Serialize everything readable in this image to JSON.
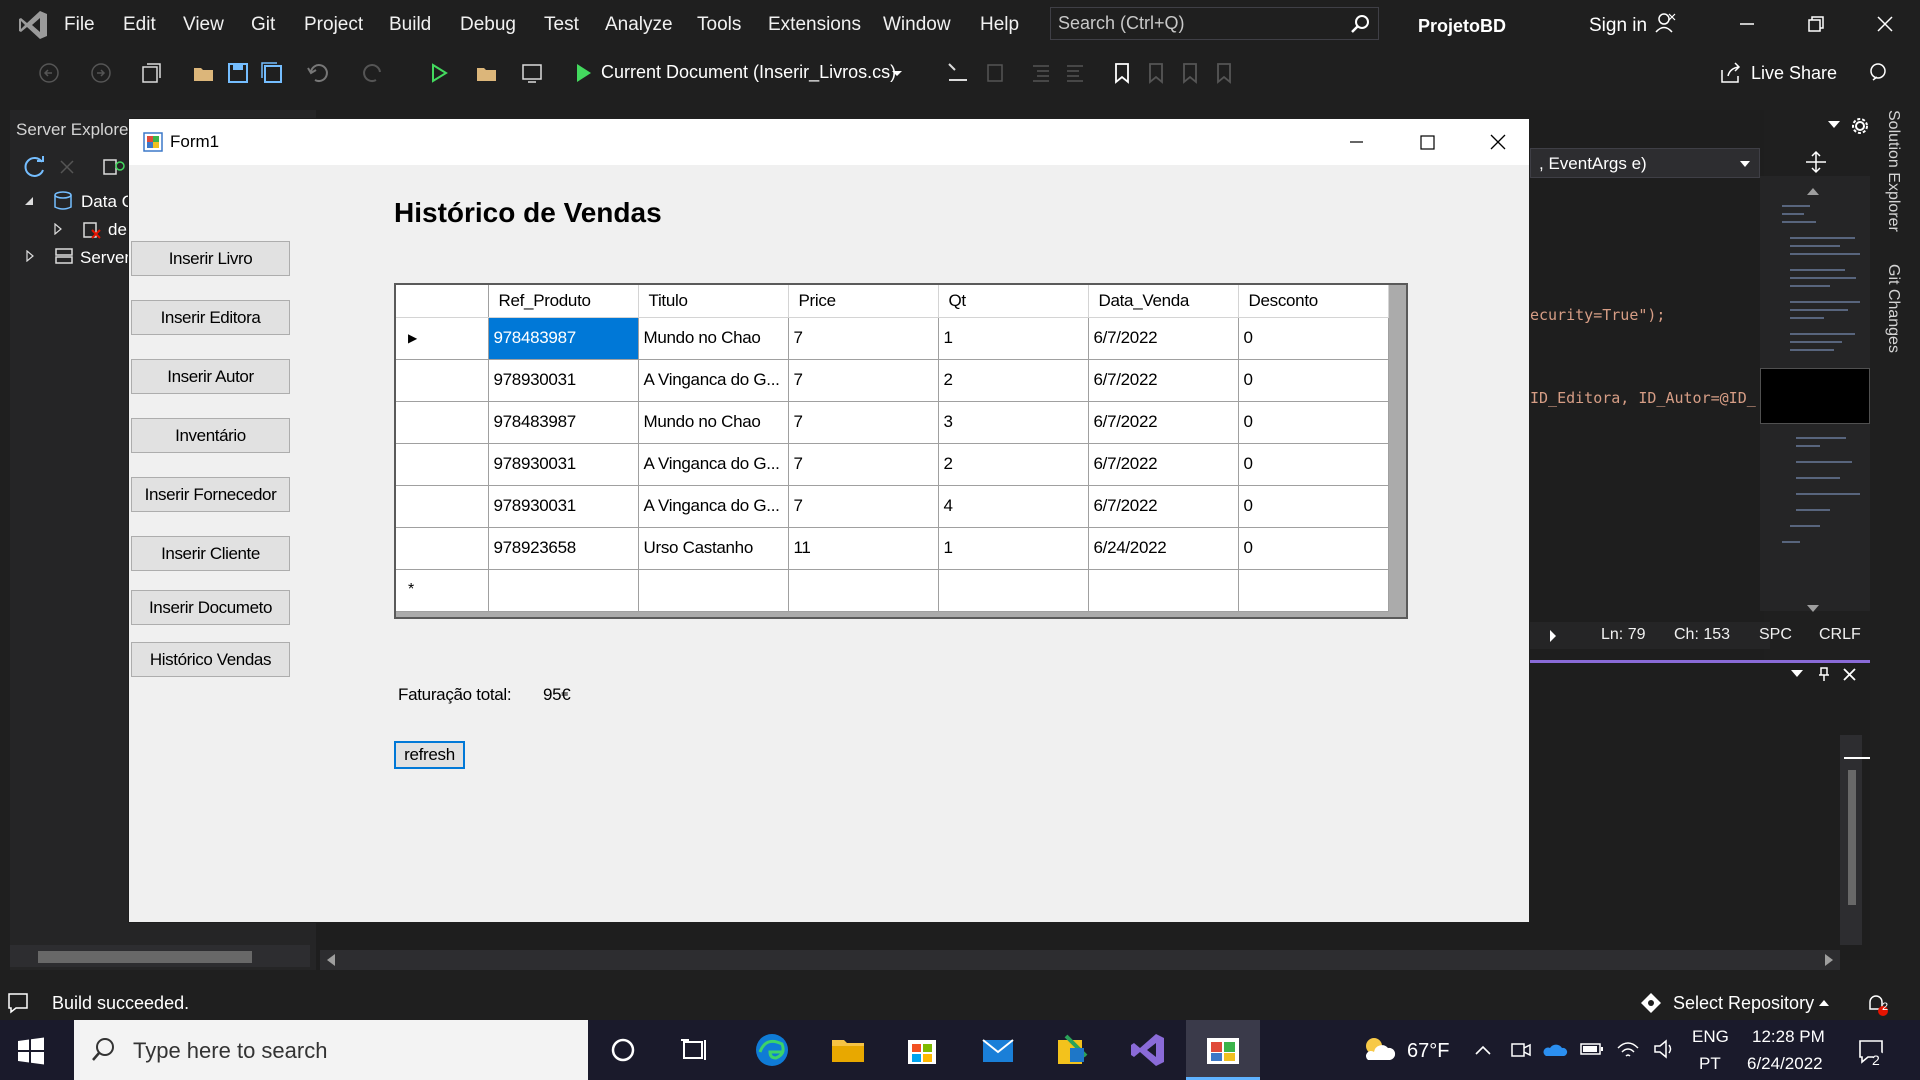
{
  "vs": {
    "menu": [
      "File",
      "Edit",
      "View",
      "Git",
      "Project",
      "Build",
      "Debug",
      "Test",
      "Analyze",
      "Tools",
      "Extensions",
      "Window",
      "Help"
    ],
    "search_placeholder": "Search (Ctrl+Q)",
    "project_name": "ProjetoBD",
    "sign_in": "Sign in",
    "run_target": "Current Document (Inserir_Livros.cs)",
    "live_share": "Live Share",
    "server_explorer_tab": "Server Explore",
    "tree": [
      {
        "label": "Data C"
      },
      {
        "label": "de"
      },
      {
        "label": "Server"
      }
    ],
    "editor_dropdown": ", EventArgs e)",
    "code_fragments": [
      "ecurity=True\");",
      "ID_Editora, ID_Autor=@ID_"
    ],
    "editor_status": {
      "line": "Ln: 79",
      "char": "Ch: 153",
      "spc": "SPC",
      "eol": "CRLF"
    },
    "rails": [
      "Solution Explorer",
      "Git Changes"
    ],
    "status_text": "Build succeeded.",
    "repo": "Select Repository"
  },
  "form": {
    "title": "Form1",
    "heading": "Histórico de Vendas",
    "sidebar_buttons": [
      "Inserir Livro",
      "Inserir Editora",
      "Inserir Autor",
      "Inventário",
      "Inserir Fornecedor",
      "Inserir Cliente",
      "Inserir Documeto",
      "Histórico Vendas"
    ],
    "grid": {
      "columns": [
        "Ref_Produto",
        "Titulo",
        "Price",
        "Qt",
        "Data_Venda",
        "Desconto"
      ],
      "rows": [
        [
          "978483987",
          "Mundo no Chao",
          "7",
          "1",
          "6/7/2022",
          "0"
        ],
        [
          "978930031",
          "A Vinganca do G...",
          "7",
          "2",
          "6/7/2022",
          "0"
        ],
        [
          "978483987",
          "Mundo no Chao",
          "7",
          "3",
          "6/7/2022",
          "0"
        ],
        [
          "978930031",
          "A Vinganca do G...",
          "7",
          "2",
          "6/7/2022",
          "0"
        ],
        [
          "978930031",
          "A Vinganca do G...",
          "7",
          "4",
          "6/7/2022",
          "0"
        ],
        [
          "978923658",
          "Urso Castanho",
          "11",
          "1",
          "6/24/2022",
          "0"
        ]
      ],
      "selected": {
        "row": 0,
        "col": 0
      }
    },
    "faturacao_label": "Faturação total:",
    "faturacao_value": "95€",
    "refresh_label": "refresh"
  },
  "taskbar": {
    "search_placeholder": "Type here to search",
    "weather": "67°F",
    "lang_top": "ENG",
    "lang_bottom": "PT",
    "time": "12:28 PM",
    "date": "6/24/2022",
    "notif_count": "2"
  },
  "colors": {
    "vs_bg": "#1f1f1f",
    "accent": "#0078d7",
    "vs_purple": "#8a6bd8"
  }
}
